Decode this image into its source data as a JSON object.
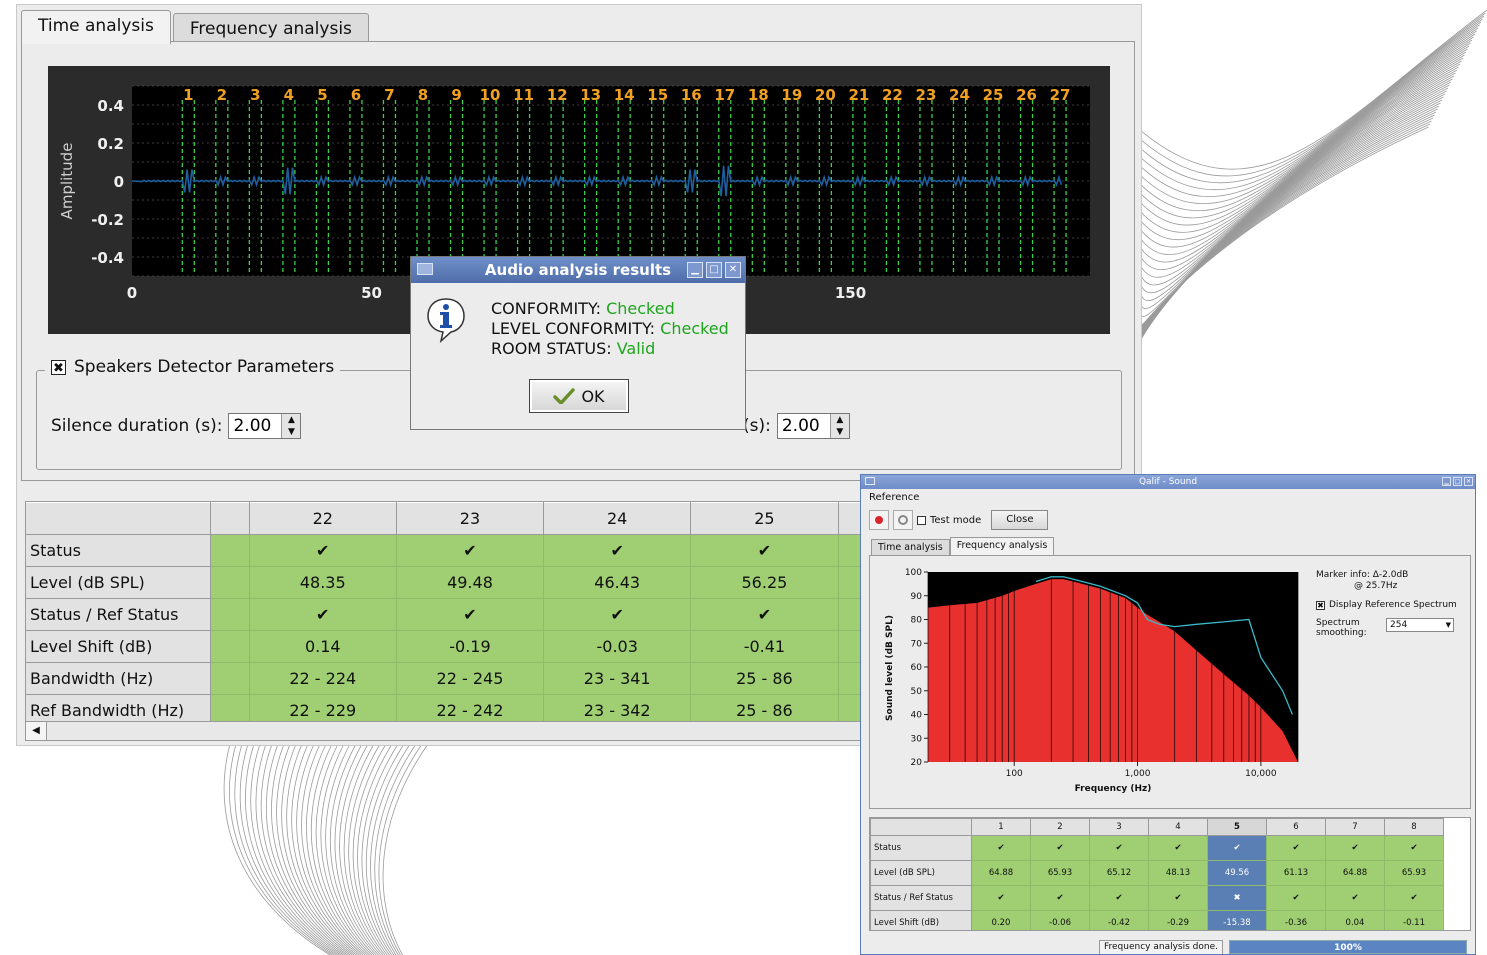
{
  "main": {
    "tabs": [
      {
        "label": "Time analysis",
        "active": true
      },
      {
        "label": "Frequency analysis",
        "active": false
      }
    ],
    "time_plot": {
      "ylabel": "Amplitude",
      "y_ticks": [
        "0.4",
        "0.2",
        "0",
        "-0.2",
        "-0.4"
      ],
      "x_ticks": [
        "0",
        "50",
        "150"
      ],
      "markers": [
        "1",
        "2",
        "3",
        "4",
        "5",
        "6",
        "7",
        "8",
        "9",
        "10",
        "11",
        "12",
        "13",
        "14",
        "15",
        "16",
        "17",
        "18",
        "19",
        "20",
        "21",
        "22",
        "23",
        "24",
        "25",
        "26",
        "27"
      ],
      "colors": {
        "background": "#000000",
        "frame": "#2b2b2b",
        "signal": "#1f5f9e",
        "marker": "#39d14a",
        "marker_label": "#f0a022"
      }
    },
    "group": {
      "title": "Speakers Detector Parameters",
      "checked": true,
      "silence_label": "Silence duration (s):",
      "silence_value": "2.00",
      "second_label": "(s):",
      "second_value": "2.00"
    },
    "table": {
      "columns": [
        "22",
        "23",
        "24",
        "25"
      ],
      "rows": [
        {
          "label": "Status",
          "values": [
            "✔",
            "✔",
            "✔",
            "✔"
          ]
        },
        {
          "label": "Level (dB SPL)",
          "values": [
            "48.35",
            "49.48",
            "46.43",
            "56.25"
          ]
        },
        {
          "label": "Status / Ref Status",
          "values": [
            "✔",
            "✔",
            "✔",
            "✔"
          ]
        },
        {
          "label": "Level Shift (dB)",
          "values": [
            "0.14",
            "-0.19",
            "-0.03",
            "-0.41"
          ]
        },
        {
          "label": "Bandwidth (Hz)",
          "values": [
            "22 - 224",
            "22 - 245",
            "23 - 341",
            "25 - 86"
          ]
        },
        {
          "label": "Ref Bandwidth (Hz)",
          "values": [
            "22 - 229",
            "22 - 242",
            "23 - 342",
            "25 - 86"
          ]
        }
      ]
    }
  },
  "dialog": {
    "title": "Audio analysis results",
    "lines": [
      {
        "label": "CONFORMITY:",
        "value": "Checked"
      },
      {
        "label": "LEVEL CONFORMITY:",
        "value": "Checked"
      },
      {
        "label": "ROOM STATUS:",
        "value": "Valid"
      }
    ],
    "ok_label": "OK",
    "value_color": "#1ea51e"
  },
  "sound_window": {
    "title": "Qalif - Sound",
    "menu": "Reference",
    "test_mode_label": "Test mode",
    "close_label": "Close",
    "tabs": [
      {
        "label": "Time analysis",
        "active": false
      },
      {
        "label": "Frequency analysis",
        "active": true
      }
    ],
    "marker_info": [
      "Marker info: Δ-2.0dB",
      "@ 25.7Hz"
    ],
    "display_ref_label": "Display Reference Spectrum",
    "display_ref_checked": true,
    "smoothing_label": "Spectrum smoothing:",
    "smoothing_value": "254",
    "plot": {
      "ylabel": "Sound level (dB SPL)",
      "xlabel": "Frequency (Hz)",
      "y_ticks": [
        "100",
        "90",
        "80",
        "70",
        "60",
        "50",
        "40",
        "30",
        "20"
      ],
      "x_ticks": [
        "100",
        "1,000",
        "10,000"
      ],
      "colors": {
        "fill": "#e8302f",
        "reference": "#39b9c9",
        "background": "#000000"
      }
    },
    "table": {
      "columns": [
        "1",
        "2",
        "3",
        "4",
        "5",
        "6",
        "7",
        "8"
      ],
      "selected_column": "5",
      "rows": [
        {
          "label": "Status",
          "values": [
            "✔",
            "✔",
            "✔",
            "✔",
            "✔",
            "✔",
            "✔",
            "✔"
          ]
        },
        {
          "label": "Level (dB SPL)",
          "values": [
            "64.88",
            "65.93",
            "65.12",
            "48.13",
            "49.56",
            "61.13",
            "64.88",
            "65.93"
          ]
        },
        {
          "label": "Status / Ref Status",
          "values": [
            "✔",
            "✔",
            "✔",
            "✔",
            "✖",
            "✔",
            "✔",
            "✔"
          ]
        },
        {
          "label": "Level Shift (dB)",
          "values": [
            "0.20",
            "-0.06",
            "-0.42",
            "-0.29",
            "-15.38",
            "-0.36",
            "0.04",
            "-0.11"
          ]
        }
      ]
    },
    "status_text": "Frequency analysis done.",
    "progress": "100%"
  },
  "chart_data": {
    "type": "area",
    "title": "",
    "xlabel": "Frequency (Hz)",
    "ylabel": "Sound level (dB SPL)",
    "x_scale": "log",
    "xlim": [
      20,
      20000
    ],
    "ylim": [
      20,
      100
    ],
    "series": [
      {
        "name": "",
        "x": [
          20,
          30,
          50,
          80,
          100,
          150,
          200,
          250,
          300,
          500,
          800,
          1000,
          1200,
          1500,
          2000,
          3000,
          5000,
          8000,
          10000,
          15000,
          20000
        ],
        "values": [
          85,
          86,
          87,
          90,
          92,
          95,
          97,
          97,
          96,
          93,
          89,
          85,
          82,
          79,
          75,
          67,
          57,
          48,
          43,
          33,
          20
        ]
      },
      {
        "name": "",
        "x": [
          150,
          200,
          250,
          300,
          500,
          800,
          1000,
          1200,
          1500,
          2000,
          3000,
          5000,
          8000,
          10000,
          15000,
          18000
        ],
        "values": [
          96,
          98,
          98,
          97,
          94,
          90,
          87,
          80,
          78,
          77,
          78,
          79,
          80,
          64,
          50,
          40
        ]
      }
    ]
  }
}
